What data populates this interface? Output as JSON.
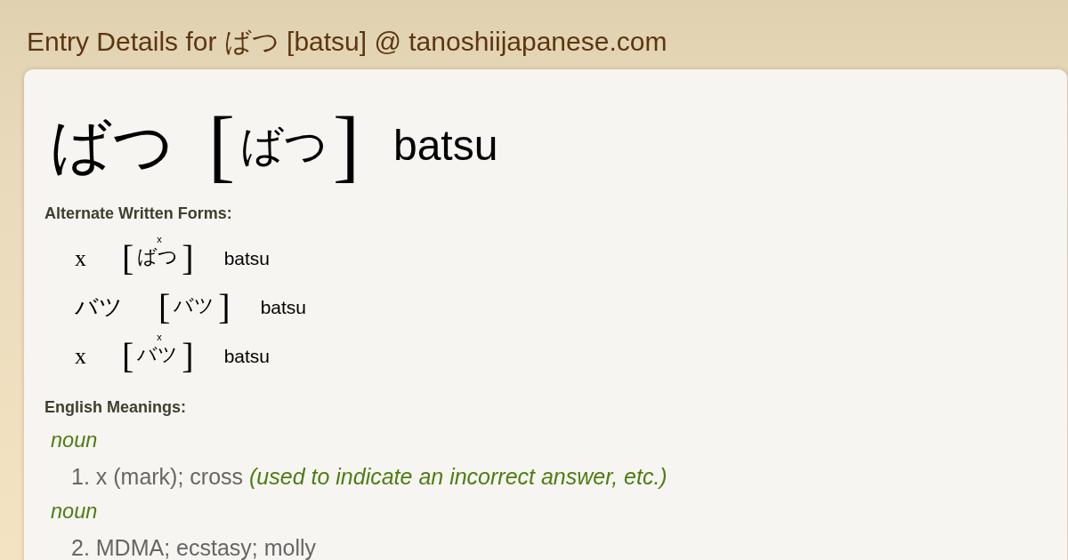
{
  "page_title": "Entry Details for ばつ [batsu] @ tanoshiijapanese.com",
  "entry": {
    "written": "ばつ",
    "bracket_open": "[",
    "reading": "ばつ",
    "bracket_close": "]",
    "romaji": "batsu"
  },
  "alternate_forms": {
    "heading": "Alternate Written Forms:",
    "items": [
      {
        "written": "x",
        "bracket_open": "[",
        "reading": "ばつ",
        "ruby": "x",
        "bracket_close": "]",
        "romaji": "batsu"
      },
      {
        "written": "バツ",
        "bracket_open": "[",
        "reading": "バツ",
        "bracket_close": "]",
        "romaji": "batsu"
      },
      {
        "written": "x",
        "bracket_open": "[",
        "reading": "バツ",
        "ruby": "x",
        "bracket_close": "]",
        "romaji": "batsu"
      }
    ]
  },
  "meanings": {
    "heading": "English Meanings:",
    "senses": [
      {
        "part_of_speech": "noun",
        "text": "1. x (mark); cross *(used to indicate an incorrect answer, etc.)*"
      },
      {
        "part_of_speech": "noun",
        "text": "2. MDMA; ecstasy; molly"
      }
    ]
  }
}
